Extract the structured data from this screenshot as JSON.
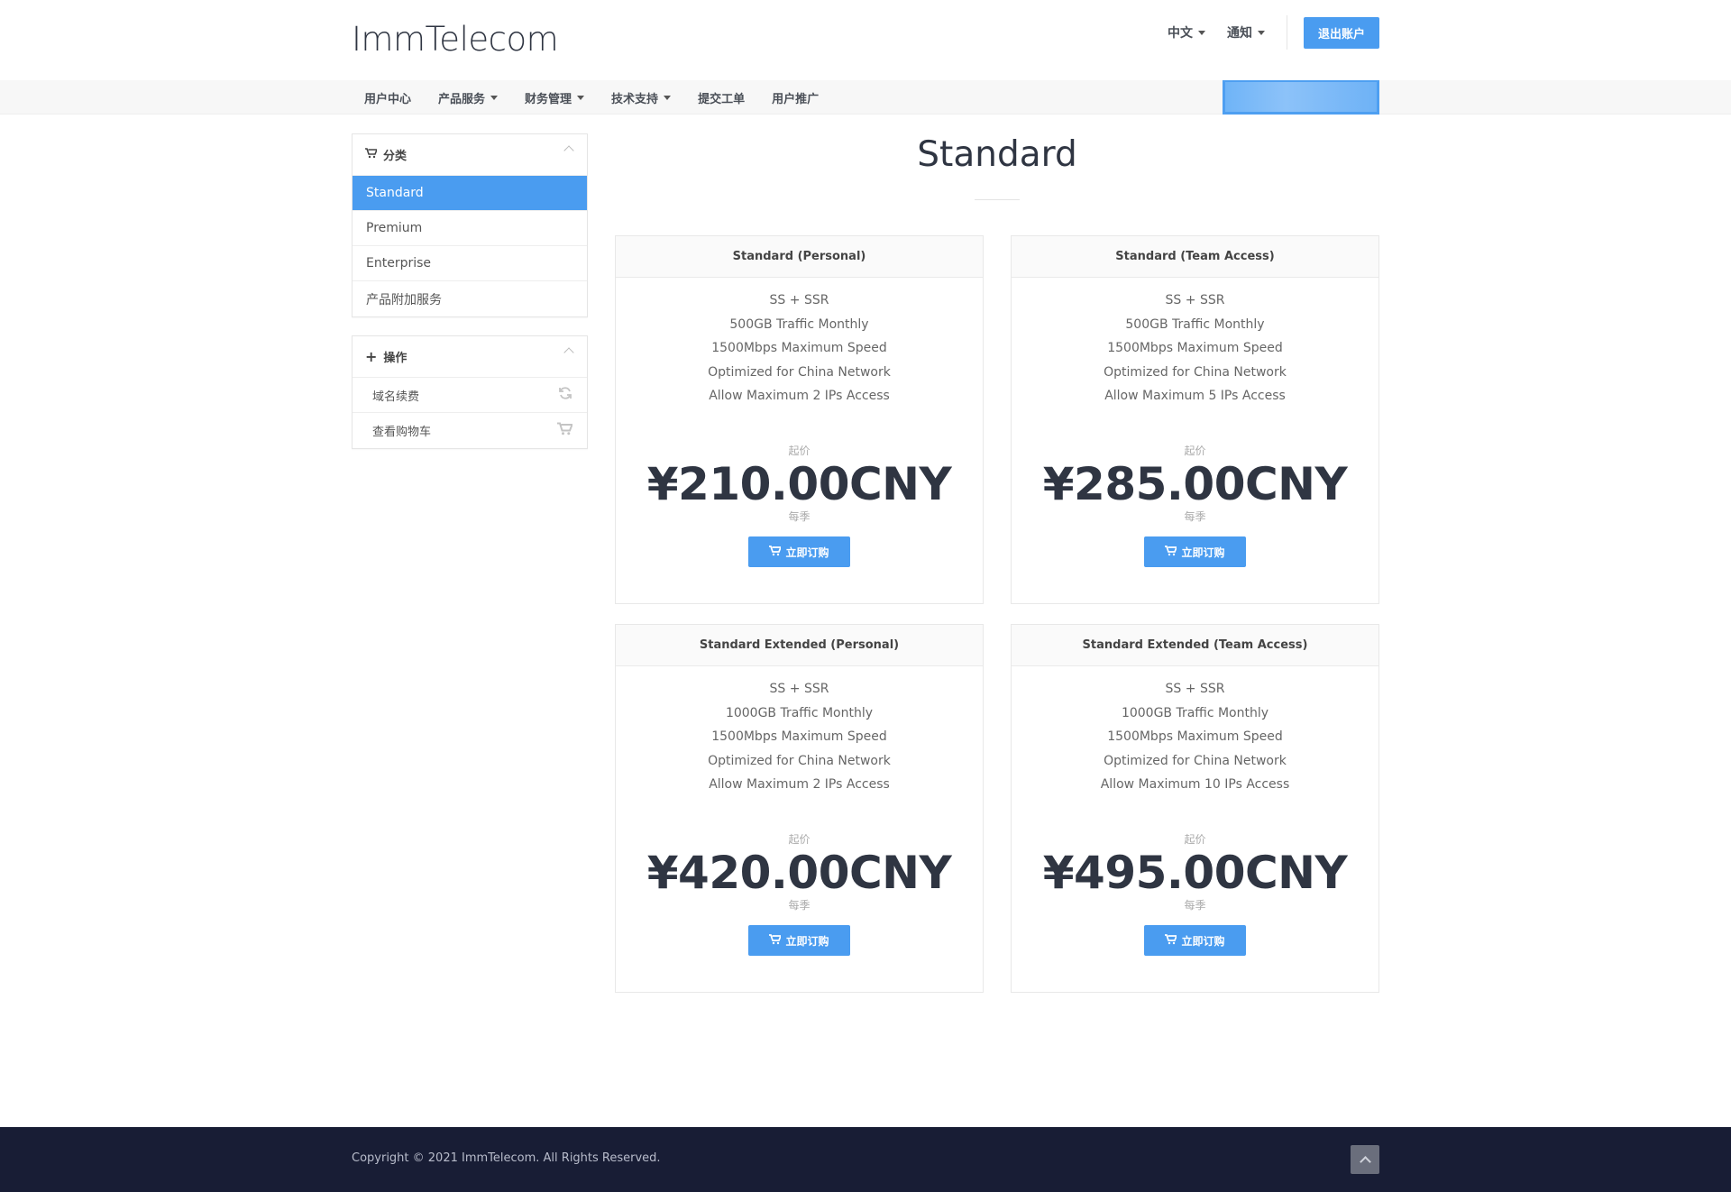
{
  "header": {
    "logo": "ImmTelecom",
    "language": "中文",
    "notifications": "通知",
    "logout": "退出账户"
  },
  "nav": {
    "items": [
      {
        "label": "用户中心",
        "dropdown": false
      },
      {
        "label": "产品服务",
        "dropdown": true
      },
      {
        "label": "财务管理",
        "dropdown": true
      },
      {
        "label": "技术支持",
        "dropdown": true
      },
      {
        "label": "提交工单",
        "dropdown": false
      },
      {
        "label": "用户推广",
        "dropdown": false
      }
    ]
  },
  "sidebar": {
    "categories_title": "分类",
    "categories": [
      "Standard",
      "Premium",
      "Enterprise",
      "产品附加服务"
    ],
    "active_category": "Standard",
    "actions_title": "操作",
    "actions": [
      {
        "label": "域名续费",
        "icon": "refresh-icon"
      },
      {
        "label": "查看购物车",
        "icon": "cart-icon"
      }
    ]
  },
  "page": {
    "title": "Standard"
  },
  "products": [
    {
      "name": "Standard (Personal)",
      "features": [
        "SS + SSR",
        "500GB Traffic Monthly",
        "1500Mbps Maximum Speed",
        "Optimized for China Network",
        "Allow Maximum 2 IPs Access"
      ],
      "from": "起价",
      "price": "¥210.00CNY",
      "cycle": "每季",
      "button": "立即订购"
    },
    {
      "name": "Standard (Team Access)",
      "features": [
        "SS + SSR",
        "500GB Traffic Monthly",
        "1500Mbps Maximum Speed",
        "Optimized for China Network",
        "Allow Maximum 5 IPs Access"
      ],
      "from": "起价",
      "price": "¥285.00CNY",
      "cycle": "每季",
      "button": "立即订购"
    },
    {
      "name": "Standard Extended (Personal)",
      "features": [
        "SS + SSR",
        "1000GB Traffic Monthly",
        "1500Mbps Maximum Speed",
        "Optimized for China Network",
        "Allow Maximum 2 IPs Access"
      ],
      "from": "起价",
      "price": "¥420.00CNY",
      "cycle": "每季",
      "button": "立即订购"
    },
    {
      "name": "Standard Extended (Team Access)",
      "features": [
        "SS + SSR",
        "1000GB Traffic Monthly",
        "1500Mbps Maximum Speed",
        "Optimized for China Network",
        "Allow Maximum 10 IPs Access"
      ],
      "from": "起价",
      "price": "¥495.00CNY",
      "cycle": "每季",
      "button": "立即订购"
    }
  ],
  "footer": {
    "copyright": "Copyright © 2021 ImmTelecom. All Rights Reserved."
  },
  "colors": {
    "accent": "#4a9cf0",
    "footer_bg": "#181d35",
    "heading": "#2f3542"
  }
}
